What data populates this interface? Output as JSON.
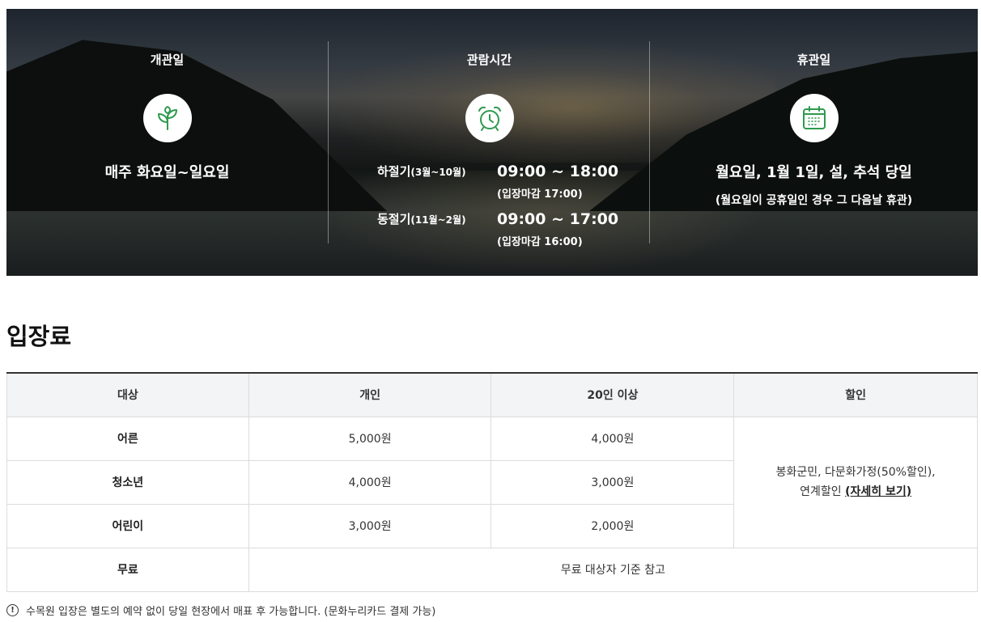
{
  "hero": {
    "open_days": {
      "heading": "개관일",
      "icon": "sprout-icon",
      "text": "매주 화요일~일요일"
    },
    "hours": {
      "heading": "관람시간",
      "icon": "alarm-clock-icon",
      "seasons": [
        {
          "label": "하절기",
          "period": "(3월~10월)",
          "time": "09:00 ~ 18:00",
          "last_entry": "(입장마감 17:00)"
        },
        {
          "label": "동절기",
          "period": "(11월~2월)",
          "time": "09:00 ~ 17:00",
          "last_entry": "(입장마감 16:00)"
        }
      ]
    },
    "closed_days": {
      "heading": "휴관일",
      "icon": "calendar-icon",
      "text": "월요일, 1월 1일, 설, 추석 당일",
      "note": "(월요일이 공휴일인 경우 그 다음날 휴관)"
    }
  },
  "fees": {
    "title": "입장료",
    "headers": [
      "대상",
      "개인",
      "20인 이상",
      "할인"
    ],
    "rows": [
      {
        "target": "어른",
        "individual": "5,000원",
        "group": "4,000원"
      },
      {
        "target": "청소년",
        "individual": "4,000원",
        "group": "3,000원"
      },
      {
        "target": "어린이",
        "individual": "3,000원",
        "group": "2,000원"
      }
    ],
    "discount_line1": "봉화군민, 다문화가정(50%할인),",
    "discount_line2": "연계할인",
    "discount_link": "(자세히 보기)",
    "free_label": "무료",
    "free_text": "무료 대상자 기준 참고"
  },
  "notice": {
    "icon_glyph": "!",
    "text": "수목원 입장은 별도의 예약 없이 당일 현장에서 매표 후 가능합니다. (문화누리카드 결제 가능)"
  },
  "colors": {
    "accent_green": "#2e9a4e",
    "header_bg": "#f3f4f6"
  }
}
